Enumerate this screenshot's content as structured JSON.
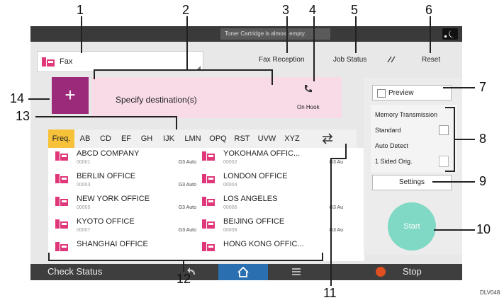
{
  "callouts": [
    "1",
    "2",
    "3",
    "4",
    "5",
    "6",
    "7",
    "8",
    "9",
    "10",
    "11",
    "12",
    "13",
    "14"
  ],
  "figure_code": "DLV048",
  "status_message": "Toner Cartridge is almost empty.",
  "app": {
    "title": "Fax"
  },
  "top_buttons": {
    "fax_reception": "Fax Reception",
    "job_status": "Job Status",
    "reset": "Reset"
  },
  "destination": {
    "label": "Specify destination(s)",
    "on_hook": "On Hook"
  },
  "tabs": [
    "Freq.",
    "AB",
    "CD",
    "EF",
    "GH",
    "IJK",
    "LMN",
    "OPQ",
    "RST",
    "UVW",
    "XYZ"
  ],
  "entries": [
    {
      "name": "ABCD COMPANY",
      "no": "00001",
      "mode": "G3 Auto"
    },
    {
      "name": "YOKOHAMA OFFIC...",
      "no": "00002",
      "mode": "G3 Au"
    },
    {
      "name": "BERLIN OFFICE",
      "no": "00003",
      "mode": "G3 Auto"
    },
    {
      "name": "LONDON OFFICE",
      "no": "00004",
      "mode": ""
    },
    {
      "name": "NEW YORK OFFICE",
      "no": "00005",
      "mode": "G3 Auto"
    },
    {
      "name": "LOS ANGELES",
      "no": "00006",
      "mode": "G3 Au"
    },
    {
      "name": "KYOTO OFFICE",
      "no": "00007",
      "mode": "G3 Auto"
    },
    {
      "name": "BEIJING OFFICE",
      "no": "00008",
      "mode": "G3 Au"
    },
    {
      "name": "SHANGHAI  OFFICE",
      "no": "",
      "mode": ""
    },
    {
      "name": "HONG KONG OFFIC...",
      "no": "",
      "mode": ""
    }
  ],
  "panel": {
    "preview": "Preview",
    "memory_tx": "Memory Transmission",
    "standard": "Standard",
    "auto_detect": "Auto Detect",
    "one_sided": "1 Sided Orig.",
    "settings": "Settings",
    "start": "Start"
  },
  "bottom": {
    "check_status": "Check Status",
    "stop": "Stop"
  },
  "colors": {
    "accent_pink": "#e0367a",
    "plus_purple": "#9c2a7a",
    "tab_active": "#f7c23a",
    "start_teal": "#7fd9c4",
    "stop_red": "#e0501e"
  }
}
